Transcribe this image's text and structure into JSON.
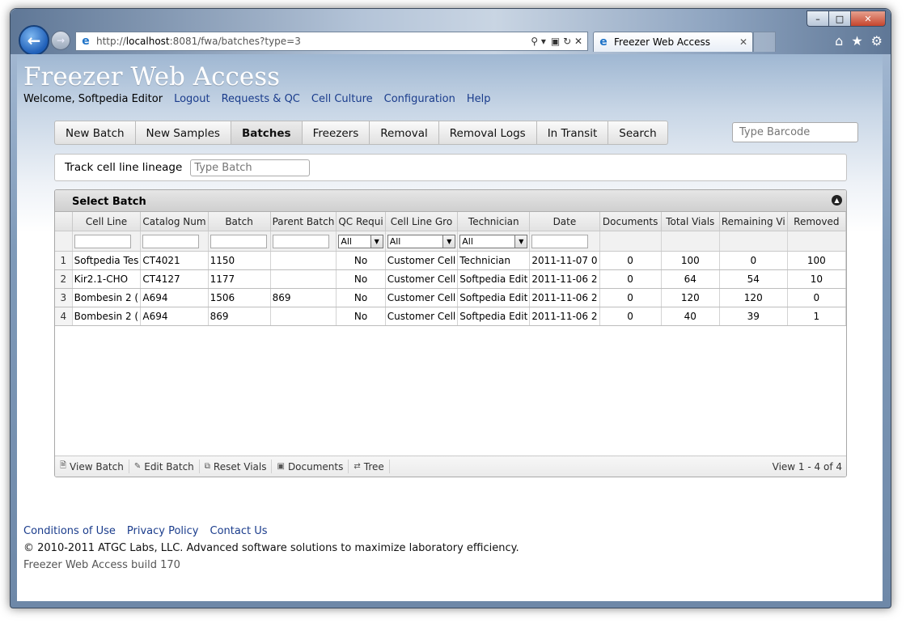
{
  "browser": {
    "url_prefix": "http://",
    "url_host": "localhost",
    "url_rest": ":8081/fwa/batches?type=3",
    "tab_title": "Freezer Web Access",
    "search_glyph": "⚲ ▾",
    "tools_glyphs": "▣ ↻ ✕"
  },
  "header": {
    "title": "Freezer Web Access",
    "welcome": "Welcome, Softpedia Editor",
    "links": [
      "Logout",
      "Requests & QC",
      "Cell Culture",
      "Configuration",
      "Help"
    ]
  },
  "nav": {
    "items": [
      "New Batch",
      "New Samples",
      "Batches",
      "Freezers",
      "Removal",
      "Removal Logs",
      "In Transit",
      "Search"
    ],
    "active": "Batches",
    "barcode_placeholder": "Type Barcode"
  },
  "lineage": {
    "label": "Track cell line lineage",
    "placeholder": "Type Batch"
  },
  "grid": {
    "caption": "Select Batch",
    "columns": [
      "Cell Line",
      "Catalog Num",
      "Batch",
      "Parent Batch",
      "QC Requi",
      "Cell Line Gro",
      "Technician",
      "Date",
      "Documents",
      "Total Vials",
      "Remaining Vi",
      "Removed"
    ],
    "filter_all": "All",
    "rows": [
      {
        "n": "1",
        "cells": [
          "Softpedia Tes",
          "CT4021",
          "1150",
          "",
          "No",
          "Customer Cell",
          "Technician",
          "2011-11-07 0",
          "0",
          "100",
          "0",
          "100"
        ]
      },
      {
        "n": "2",
        "cells": [
          "Kir2.1-CHO",
          "CT4127",
          "1177",
          "",
          "No",
          "Customer Cell",
          "Softpedia Edit",
          "2011-11-06 2",
          "0",
          "64",
          "54",
          "10"
        ]
      },
      {
        "n": "3",
        "cells": [
          "Bombesin 2 (",
          "A694",
          "1506",
          "869",
          "No",
          "Customer Cell",
          "Softpedia Edit",
          "2011-11-06 2",
          "0",
          "120",
          "120",
          "0"
        ]
      },
      {
        "n": "4",
        "cells": [
          "Bombesin 2 (",
          "A694",
          "869",
          "",
          "No",
          "Customer Cell",
          "Softpedia Edit",
          "2011-11-06 2",
          "0",
          "40",
          "39",
          "1"
        ]
      }
    ],
    "pager_buttons": [
      "View Batch",
      "Edit Batch",
      "Reset Vials",
      "Documents",
      "Tree"
    ],
    "view_info": "View 1 - 4 of 4"
  },
  "footer": {
    "links": [
      "Conditions of Use",
      "Privacy Policy",
      "Contact Us"
    ],
    "copyright": "© 2010-2011 ATGC Labs, LLC. Advanced software solutions to maximize laboratory efficiency.",
    "build": "Freezer Web Access build 170"
  }
}
